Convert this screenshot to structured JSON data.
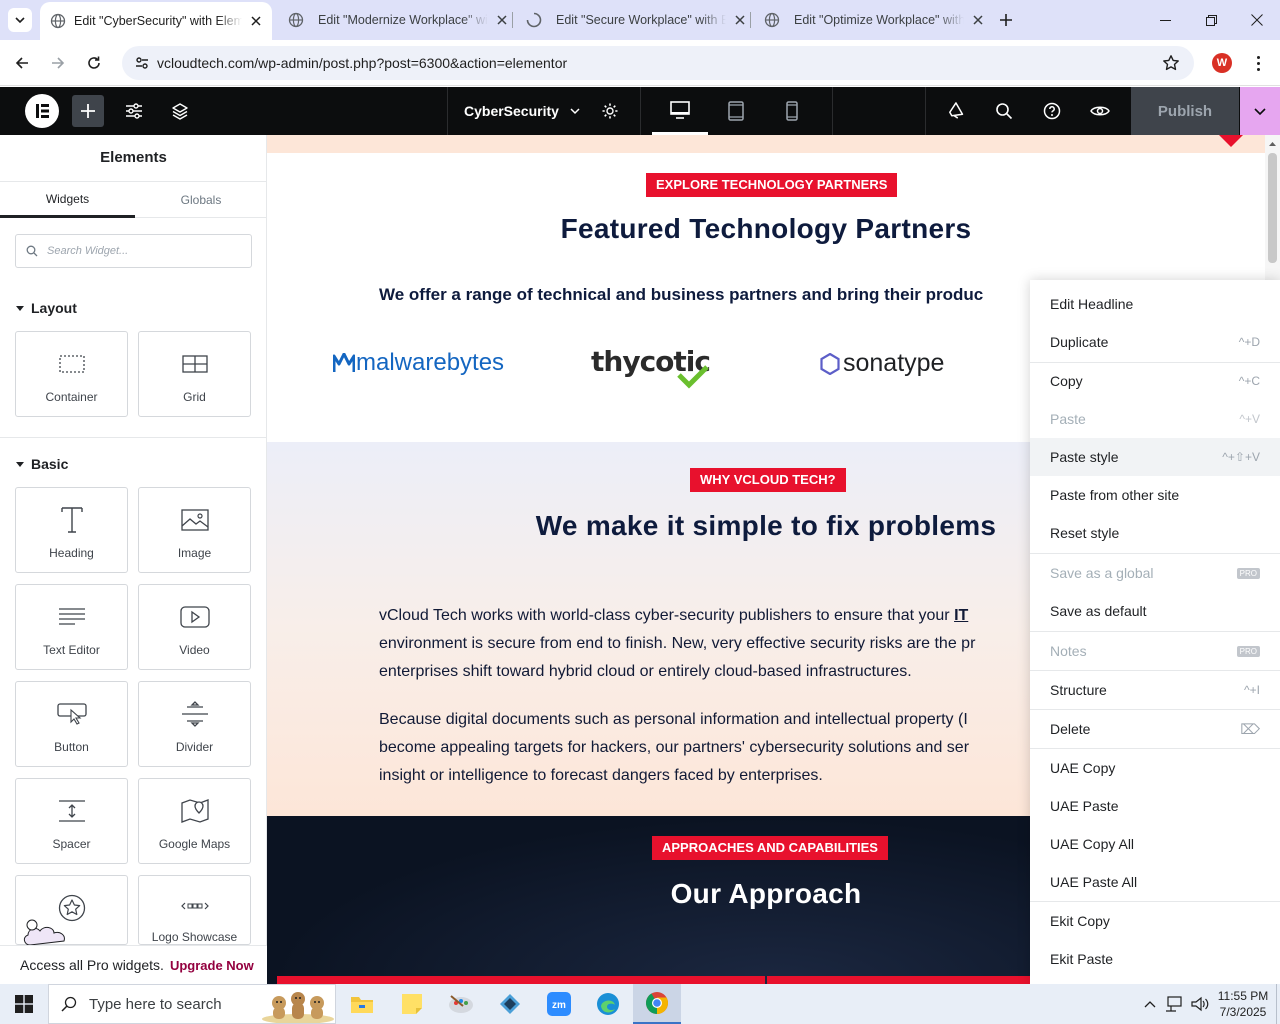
{
  "browser": {
    "tabs": [
      {
        "title": "Edit \"CyberSecurity\" with Elementor",
        "active": true
      },
      {
        "title": "Edit \"Modernize Workplace\" with Elementor",
        "active": false
      },
      {
        "title": "Edit \"Secure Workplace\" with Elementor",
        "active": false
      },
      {
        "title": "Edit \"Optimize Workplace\" with Elementor",
        "active": false
      }
    ],
    "url": "vcloudtech.com/wp-admin/post.php?post=6300&action=elementor",
    "profile_initial": "W"
  },
  "editor_bar": {
    "document_title": "CyberSecurity",
    "publish_label": "Publish"
  },
  "panel": {
    "title": "Elements",
    "tabs": [
      "Widgets",
      "Globals"
    ],
    "search_placeholder": "Search Widget...",
    "sections": {
      "layout": "Layout",
      "basic": "Basic"
    },
    "layout_widgets": [
      {
        "label": "Container",
        "icon": "container-icon"
      },
      {
        "label": "Grid",
        "icon": "grid-icon"
      }
    ],
    "basic_widgets": [
      {
        "label": "Heading",
        "icon": "heading-icon"
      },
      {
        "label": "Image",
        "icon": "image-icon"
      },
      {
        "label": "Text Editor",
        "icon": "text-editor-icon"
      },
      {
        "label": "Video",
        "icon": "video-icon"
      },
      {
        "label": "Button",
        "icon": "button-icon"
      },
      {
        "label": "Divider",
        "icon": "divider-icon"
      },
      {
        "label": "Spacer",
        "icon": "spacer-icon"
      },
      {
        "label": "Google Maps",
        "icon": "map-icon"
      },
      {
        "label": "",
        "icon": "star-icon"
      },
      {
        "label": "Logo Showcase",
        "icon": "logo-showcase-icon"
      }
    ],
    "promo_text": "Access all Pro widgets.",
    "promo_link": "Upgrade Now"
  },
  "page": {
    "partners_badge": "EXPLORE TECHNOLOGY PARTNERS",
    "partners_heading": "Featured Technology Partners",
    "partners_sub": "We offer a range of technical and business partners and bring their produc",
    "partner_logos": [
      "Malwarebytes",
      "thycotic",
      "sonatype"
    ],
    "why_badge": "WHY VCLOUD TECH?",
    "why_heading": "We make it simple to fix problems",
    "paragraph1": [
      "vCloud Tech works with world-class cyber-security publishers to ensure that your",
      "environment is secure from end to finish. New, very effective security risks are the pr",
      "enterprises shift toward hybrid cloud or entirely cloud-based infrastructures."
    ],
    "paragraph1_link": "IT",
    "paragraph2": [
      "Because digital documents such as personal information and intellectual property (I",
      "become appealing targets for hackers, our partners' cybersecurity solutions and ser",
      "insight or intelligence to forecast dangers faced by enterprises."
    ],
    "approach_badge": "APPROACHES AND CAPABILITIES",
    "approach_heading": "Our Approach"
  },
  "context_menu": [
    {
      "label": "Edit Headline",
      "shortcut": ""
    },
    {
      "label": "Duplicate",
      "shortcut": "^+D"
    },
    {
      "label": "Copy",
      "shortcut": "^+C"
    },
    {
      "label": "Paste",
      "shortcut": "^+V",
      "disabled": true
    },
    {
      "label": "Paste style",
      "shortcut": "^+⇧+V",
      "hover": true
    },
    {
      "label": "Paste from other site",
      "shortcut": ""
    },
    {
      "label": "Reset style",
      "shortcut": ""
    },
    {
      "label": "Save as a global",
      "shortcut": "",
      "badge": "PRO",
      "disabled": true
    },
    {
      "label": "Save as default",
      "shortcut": ""
    },
    {
      "label": "Notes",
      "shortcut": "",
      "badge": "PRO",
      "disabled": true
    },
    {
      "label": "Structure",
      "shortcut": "^+I"
    },
    {
      "label": "Delete",
      "shortcut": "⌦"
    },
    {
      "label": "UAE Copy",
      "shortcut": ""
    },
    {
      "label": "UAE Paste",
      "shortcut": ""
    },
    {
      "label": "UAE Copy All",
      "shortcut": ""
    },
    {
      "label": "UAE Paste All",
      "shortcut": ""
    },
    {
      "label": "Ekit Copy",
      "shortcut": ""
    },
    {
      "label": "Ekit Paste",
      "shortcut": ""
    }
  ],
  "taskbar": {
    "search_placeholder": "Type here to search",
    "time": "11:55 PM",
    "date": "7/3/2025"
  },
  "colors": {
    "accent_red": "#e8112d",
    "navy": "#0e1b3d",
    "elementor_pink": "#e6a6f0",
    "upgrade_link": "#93003f"
  }
}
